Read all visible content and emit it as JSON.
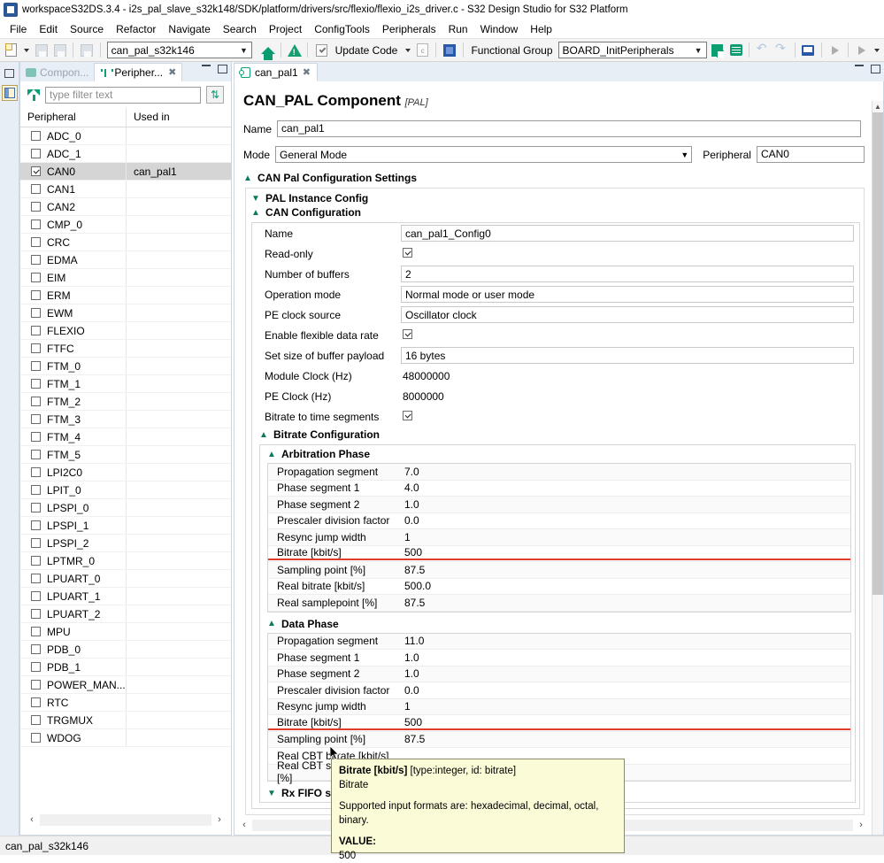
{
  "window": {
    "title": "workspaceS32DS.3.4 - i2s_pal_slave_s32k148/SDK/platform/drivers/src/flexio/flexio_i2s_driver.c - S32 Design Studio for S32 Platform",
    "app_icon": "s32ds-icon"
  },
  "menu": {
    "items": [
      "File",
      "Edit",
      "Source",
      "Refactor",
      "Navigate",
      "Search",
      "Project",
      "ConfigTools",
      "Peripherals",
      "Run",
      "Window",
      "Help"
    ]
  },
  "toolbar": {
    "project_combo_value": "can_pal_s32k146",
    "update_code_label": "Update Code",
    "functional_group_label": "Functional Group",
    "functional_group_value": "BOARD_InitPeripherals",
    "icons": [
      "new-file-icon",
      "save-icon",
      "save-all-icon",
      "binary-icon",
      "home-icon",
      "warning-icon",
      "update-code-icon",
      "c-file-icon",
      "chip-icon",
      "flag-icon",
      "report-icon",
      "undo-icon",
      "redo-icon",
      "console-icon",
      "run-icon",
      "debug-icon"
    ]
  },
  "peripherals_view": {
    "tabs": [
      {
        "label": "Compon...",
        "icon": "components-icon",
        "active": false,
        "closable": false
      },
      {
        "label": "Peripher...",
        "icon": "peripherals-icon",
        "active": true,
        "closable": true
      }
    ],
    "filter_placeholder": "type filter text",
    "filter_value": "",
    "sort_button": "sort-icon",
    "columns": [
      "Peripheral",
      "Used in"
    ],
    "rows": [
      {
        "name": "ADC_0",
        "checked": false,
        "used_in": "",
        "selected": false
      },
      {
        "name": "ADC_1",
        "checked": false,
        "used_in": "",
        "selected": false
      },
      {
        "name": "CAN0",
        "checked": true,
        "used_in": "can_pal1",
        "selected": true
      },
      {
        "name": "CAN1",
        "checked": false,
        "used_in": "",
        "selected": false
      },
      {
        "name": "CAN2",
        "checked": false,
        "used_in": "",
        "selected": false
      },
      {
        "name": "CMP_0",
        "checked": false,
        "used_in": "",
        "selected": false
      },
      {
        "name": "CRC",
        "checked": false,
        "used_in": "",
        "selected": false
      },
      {
        "name": "EDMA",
        "checked": false,
        "used_in": "",
        "selected": false
      },
      {
        "name": "EIM",
        "checked": false,
        "used_in": "",
        "selected": false
      },
      {
        "name": "ERM",
        "checked": false,
        "used_in": "",
        "selected": false
      },
      {
        "name": "EWM",
        "checked": false,
        "used_in": "",
        "selected": false
      },
      {
        "name": "FLEXIO",
        "checked": false,
        "used_in": "",
        "selected": false
      },
      {
        "name": "FTFC",
        "checked": false,
        "used_in": "",
        "selected": false
      },
      {
        "name": "FTM_0",
        "checked": false,
        "used_in": "",
        "selected": false
      },
      {
        "name": "FTM_1",
        "checked": false,
        "used_in": "",
        "selected": false
      },
      {
        "name": "FTM_2",
        "checked": false,
        "used_in": "",
        "selected": false
      },
      {
        "name": "FTM_3",
        "checked": false,
        "used_in": "",
        "selected": false
      },
      {
        "name": "FTM_4",
        "checked": false,
        "used_in": "",
        "selected": false
      },
      {
        "name": "FTM_5",
        "checked": false,
        "used_in": "",
        "selected": false
      },
      {
        "name": "LPI2C0",
        "checked": false,
        "used_in": "",
        "selected": false
      },
      {
        "name": "LPIT_0",
        "checked": false,
        "used_in": "",
        "selected": false
      },
      {
        "name": "LPSPI_0",
        "checked": false,
        "used_in": "",
        "selected": false
      },
      {
        "name": "LPSPI_1",
        "checked": false,
        "used_in": "",
        "selected": false
      },
      {
        "name": "LPSPI_2",
        "checked": false,
        "used_in": "",
        "selected": false
      },
      {
        "name": "LPTMR_0",
        "checked": false,
        "used_in": "",
        "selected": false
      },
      {
        "name": "LPUART_0",
        "checked": false,
        "used_in": "",
        "selected": false
      },
      {
        "name": "LPUART_1",
        "checked": false,
        "used_in": "",
        "selected": false
      },
      {
        "name": "LPUART_2",
        "checked": false,
        "used_in": "",
        "selected": false
      },
      {
        "name": "MPU",
        "checked": false,
        "used_in": "",
        "selected": false
      },
      {
        "name": "PDB_0",
        "checked": false,
        "used_in": "",
        "selected": false
      },
      {
        "name": "PDB_1",
        "checked": false,
        "used_in": "",
        "selected": false
      },
      {
        "name": "POWER_MAN...",
        "checked": false,
        "used_in": "",
        "selected": false
      },
      {
        "name": "RTC",
        "checked": false,
        "used_in": "",
        "selected": false
      },
      {
        "name": "TRGMUX",
        "checked": false,
        "used_in": "",
        "selected": false
      },
      {
        "name": "WDOG",
        "checked": false,
        "used_in": "",
        "selected": false
      }
    ]
  },
  "editor": {
    "tab": {
      "label": "can_pal1",
      "icon": "pal-component-icon"
    },
    "title": "CAN_PAL Component",
    "title_suffix": "[PAL]",
    "name_label": "Name",
    "name_value": "can_pal1",
    "mode_label": "Mode",
    "mode_value": "General Mode",
    "peripheral_label": "Peripheral",
    "peripheral_value": "CAN0",
    "sections": {
      "can_pal_settings": "CAN Pal Configuration Settings",
      "pal_instance_config": "PAL Instance Config",
      "can_configuration": "CAN Configuration",
      "bitrate_configuration": "Bitrate Configuration",
      "arbitration_phase": "Arbitration Phase",
      "data_phase": "Data Phase",
      "rx_fifo_settings": "Rx FIFO settings"
    },
    "can_config_rows": [
      {
        "label": "Name",
        "value": "can_pal1_Config0",
        "kind": "text"
      },
      {
        "label": "Read-only",
        "value": "",
        "kind": "checkbox",
        "checked": true
      },
      {
        "label": "Number of buffers",
        "value": "2",
        "kind": "text"
      },
      {
        "label": "Operation mode",
        "value": "Normal mode or user mode",
        "kind": "text"
      },
      {
        "label": "PE clock source",
        "value": "Oscillator clock",
        "kind": "text"
      },
      {
        "label": "Enable flexible data rate",
        "value": "",
        "kind": "checkbox",
        "checked": true
      },
      {
        "label": "Set size of buffer payload",
        "value": "16 bytes",
        "kind": "text"
      },
      {
        "label": "Module Clock (Hz)",
        "value": "48000000",
        "kind": "static"
      },
      {
        "label": "PE Clock (Hz)",
        "value": "8000000",
        "kind": "static"
      },
      {
        "label": "Bitrate to time segments",
        "value": "",
        "kind": "checkbox",
        "checked": true
      }
    ],
    "arbitration_phase_rows": [
      {
        "label": "Propagation segment",
        "value": "7.0",
        "highlighted": false
      },
      {
        "label": "Phase segment 1",
        "value": "4.0",
        "highlighted": false
      },
      {
        "label": "Phase segment 2",
        "value": "1.0",
        "highlighted": false
      },
      {
        "label": "Prescaler division factor",
        "value": "0.0",
        "highlighted": false
      },
      {
        "label": "Resync jump width",
        "value": "1",
        "highlighted": false
      },
      {
        "label": "Bitrate [kbit/s]",
        "value": "500",
        "highlighted": true
      },
      {
        "label": "Sampling point [%]",
        "value": "87.5",
        "highlighted": false
      },
      {
        "label": "Real bitrate [kbit/s]",
        "value": "500.0",
        "highlighted": false
      },
      {
        "label": "Real samplepoint [%]",
        "value": "87.5",
        "highlighted": false
      }
    ],
    "data_phase_rows": [
      {
        "label": "Propagation segment",
        "value": "11.0",
        "highlighted": false
      },
      {
        "label": "Phase segment 1",
        "value": "1.0",
        "highlighted": false
      },
      {
        "label": "Phase segment 2",
        "value": "1.0",
        "highlighted": false
      },
      {
        "label": "Prescaler division factor",
        "value": "0.0",
        "highlighted": false
      },
      {
        "label": "Resync jump width",
        "value": "1",
        "highlighted": false
      },
      {
        "label": "Bitrate [kbit/s]",
        "value": "500",
        "highlighted": true
      },
      {
        "label": "Sampling point [%]",
        "value": "87.5",
        "highlighted": false
      },
      {
        "label": "Real CBT bitrate [kbit/s]",
        "value": "",
        "highlighted": false
      },
      {
        "label": "Real CBT samplepoint [%]",
        "value": "",
        "highlighted": false
      }
    ]
  },
  "tooltip": {
    "title": "Bitrate [kbit/s]",
    "meta": "[type:integer, id: bitrate]",
    "description": "Bitrate",
    "formats": "Supported input formats are: hexadecimal, decimal, octal, binary.",
    "value_label": "VALUE:",
    "value": "500"
  },
  "status_bar": {
    "text": "can_pal_s32k146"
  },
  "colors": {
    "accent_green": "#0d9d77",
    "error_red": "#e23b2e",
    "tooltip_bg": "#fbfbd8",
    "selection_gray": "#d5d5d5",
    "tab_bg": "#e8eef6"
  }
}
